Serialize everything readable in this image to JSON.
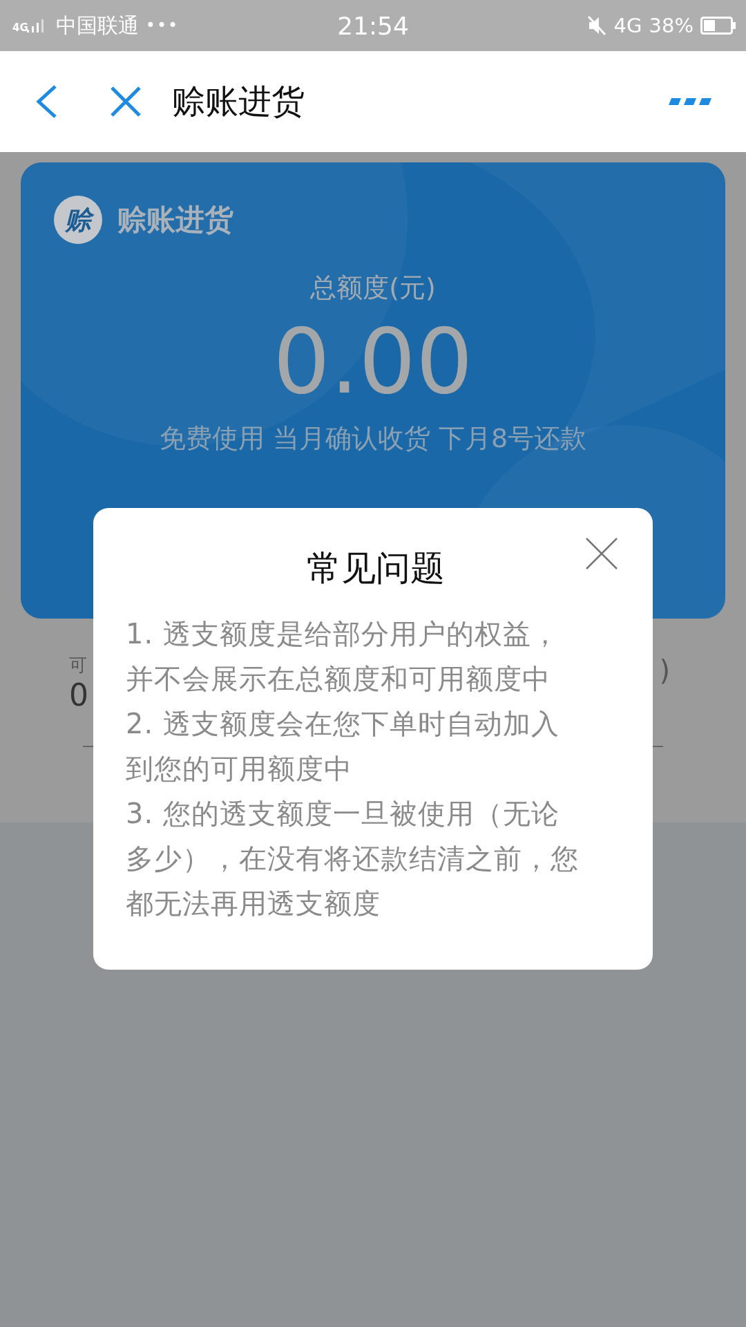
{
  "status_bar": {
    "network_small": "4G",
    "carrier": "中国联通",
    "more": "•••",
    "time": "21:54",
    "network": "4G",
    "battery": "38%"
  },
  "nav": {
    "title": "赊账进货"
  },
  "card": {
    "logo_text": "赊",
    "title": "赊账进货",
    "label": "总额度(元)",
    "amount": "0.00",
    "note": "免费使用 当月确认收货 下月8号还款"
  },
  "behind": {
    "left_label": "可",
    "left_value": "0",
    "right_label": ")"
  },
  "dialog": {
    "title": "常见问题",
    "items": [
      {
        "lines": [
          "1. 透支额度是给部分用户的权益，",
          "并不会展示在总额度和可用额度中"
        ]
      },
      {
        "lines": [
          "2. 透支额度会在您下单时自动加入",
          "到您的可用额度中"
        ]
      },
      {
        "lines": [
          "3. 您的透支额度一旦被使用（无论",
          "多少），在没有将还款结清之前，您",
          "都无法再用透支额度"
        ]
      }
    ]
  }
}
